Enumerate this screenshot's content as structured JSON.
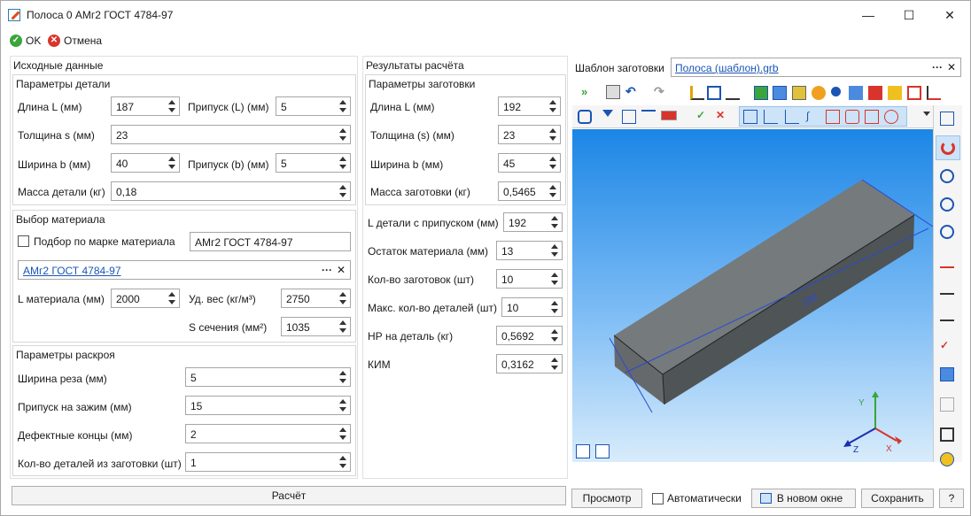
{
  "window": {
    "title": "Полоса 0 АМг2 ГОСТ 4784-97",
    "min": "—",
    "max": "☐",
    "close": "✕"
  },
  "toolbar": {
    "ok": "OK",
    "cancel": "Отмена"
  },
  "input": {
    "title": "Исходные данные",
    "part": {
      "title": "Параметры детали",
      "length_label": "Длина L (мм)",
      "length": "187",
      "allow_l_label": "Припуск (L) (мм)",
      "allow_l": "5",
      "thick_label": "Толщина s (мм)",
      "thick": "23",
      "width_label": "Ширина b (мм)",
      "width": "40",
      "allow_b_label": "Припуск (b) (мм)",
      "allow_b": "5",
      "mass_label": "Масса детали (кг)",
      "mass": "0,18"
    },
    "material": {
      "title": "Выбор материала",
      "by_grade_label": "Подбор по марке материала",
      "grade": "АМг2 ГОСТ 4784-97",
      "link": "АМг2 ГОСТ 4784-97",
      "dots": "···",
      "x": "✕",
      "lmat_label": "L материала (мм)",
      "lmat": "2000",
      "density_label": "Уд. вес (кг/м³)",
      "density": "2750",
      "section_label": "S сечения (мм²)",
      "section": "1035"
    },
    "cut": {
      "title": "Параметры раскроя",
      "kerf_label": "Ширина реза (мм)",
      "kerf": "5",
      "clamp_label": "Припуск на зажим (мм)",
      "clamp": "15",
      "ends_label": "Дефектные концы (мм)",
      "ends": "2",
      "count_label": "Кол-во деталей из заготовки (шт)",
      "count": "1"
    }
  },
  "results": {
    "title": "Результаты расчёта",
    "blank": {
      "title": "Параметры заготовки",
      "len_label": "Длина L (мм)",
      "len": "192",
      "thick_label": "Толщина (s) (мм)",
      "thick": "23",
      "width_label": "Ширина b (мм)",
      "width": "45",
      "mass_label": "Масса заготовки (кг)",
      "mass": "0,5465"
    },
    "lwith_label": "L детали с припуском (мм)",
    "lwith": "192",
    "rest_label": "Остаток материала (мм)",
    "rest": "13",
    "nblanks_label": "Кол-во заготовок (шт)",
    "nblanks": "10",
    "maxparts_label": "Макс. кол-во деталей (шт)",
    "maxparts": "10",
    "norm_label": "НР на деталь (кг)",
    "norm": "0,5692",
    "kim_label": "КИМ",
    "kim": "0,3162"
  },
  "calc_button": "Расчёт",
  "template": {
    "label": "Шаблон заготовки",
    "link": "Полоса (шаблон).grb",
    "dots": "···",
    "x": "✕"
  },
  "viewer": {
    "preview": "Просмотр",
    "auto": "Автоматически",
    "new_window": "В новом окне",
    "save": "Сохранить",
    "help": "?",
    "dim": "192",
    "axis_x": "X",
    "axis_y": "Y",
    "axis_z": "Z"
  },
  "colors": {
    "accent": "#1a55b5",
    "ok": "#3aa53a",
    "cancel": "#d9342b"
  }
}
